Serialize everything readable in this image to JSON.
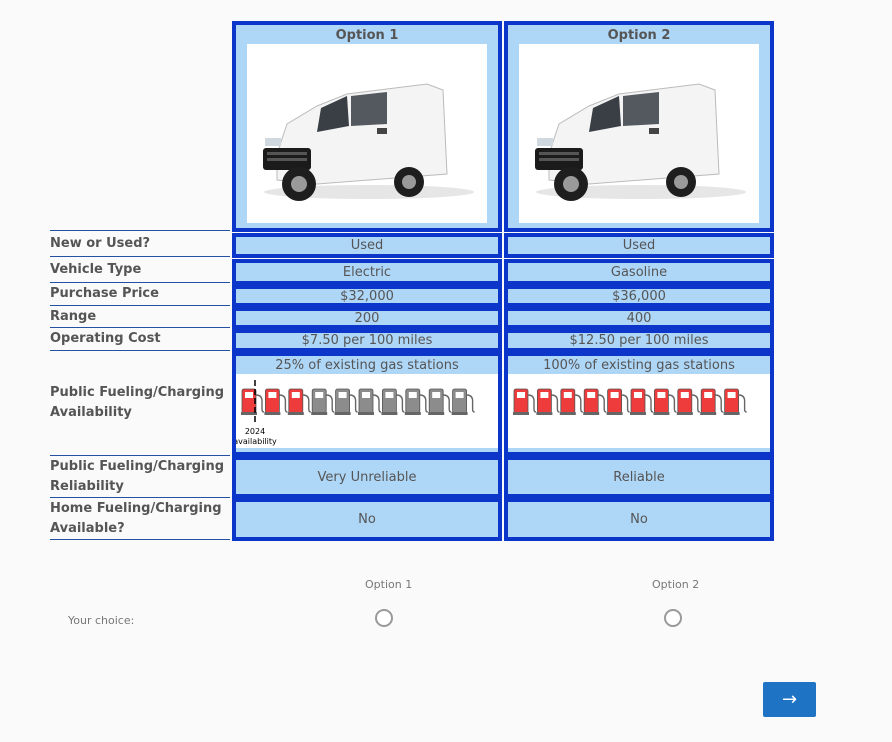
{
  "options": [
    {
      "title": "Option 1",
      "new_or_used": "Used",
      "vehicle_type": "Electric",
      "purchase_price": "$32,000",
      "range": "200",
      "operating_cost": "$7.50 per 100 miles",
      "fueling_availability": "25% of existing gas stations",
      "fueling_availability_fraction": 0.25,
      "marker_year": "2024",
      "marker_caption": "availability",
      "reliability": "Very Unreliable",
      "home_fueling": "No"
    },
    {
      "title": "Option 2",
      "new_or_used": "Used",
      "vehicle_type": "Gasoline",
      "purchase_price": "$36,000",
      "range": "400",
      "operating_cost": "$12.50 per 100 miles",
      "fueling_availability": "100% of existing gas stations",
      "fueling_availability_fraction": 1.0,
      "reliability": "Reliable",
      "home_fueling": "No"
    }
  ],
  "row_labels": {
    "new_or_used": "New or Used?",
    "vehicle_type": "Vehicle Type",
    "purchase_price": "Purchase Price",
    "range": "Range",
    "operating_cost": "Operating Cost",
    "fueling_availability": "Public Fueling/Charging Availability",
    "reliability": "Public Fueling/Charging Reliability",
    "home_fueling": "Home Fueling/Charging Available?"
  },
  "choice": {
    "prompt": "Your choice:",
    "option1_label": "Option 1",
    "option2_label": "Option 2"
  },
  "next_button": "→",
  "colors": {
    "cell_bg": "#aed6f7",
    "cell_border": "#0c35c9",
    "pump_red": "#ee3b3b",
    "pump_gray": "#8c8c8c",
    "next_bg": "#1f73c5"
  },
  "icons": {
    "vehicle": "white-cargo-van",
    "pump": "gas-pump-icon"
  }
}
